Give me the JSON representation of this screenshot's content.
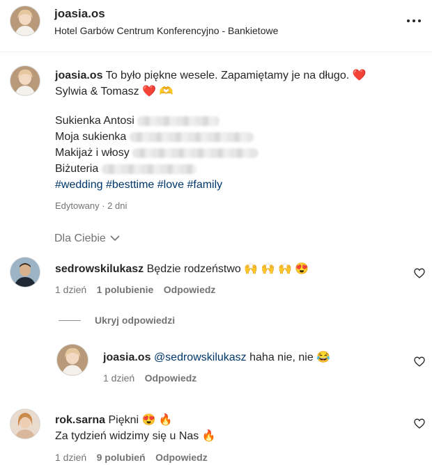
{
  "header": {
    "username": "joasia.os",
    "location": "Hotel Garbów Centrum Konferencyjno - Bankietowe"
  },
  "caption": {
    "username": "joasia.os",
    "line1": "To było piękne wesele. Zapamiętamy je na długo. ❤️",
    "line2": "Sylwia & Tomasz ❤️ 🫶",
    "credit1": "Sukienka Antosi",
    "credit2": "Moja sukienka",
    "credit3": "Makijaż i włosy",
    "credit4": "Biżuteria",
    "hashtags": [
      "#wedding",
      "#besttime",
      "#love",
      "#family"
    ],
    "edited": "Edytowany · 2 dni"
  },
  "sort": {
    "label": "Dla Ciebie"
  },
  "comments": [
    {
      "username": "sedrowskilukasz",
      "text": "Będzie rodzeństwo 🙌 🙌 🙌 😍",
      "time": "1 dzień",
      "likes": "1 polubienie",
      "reply": "Odpowiedz",
      "hide_replies": "Ukryj odpowiedzi",
      "replies": [
        {
          "username": "joasia.os",
          "mention": "@sedrowskilukasz",
          "text": "haha nie, nie 😂",
          "time": "1 dzień",
          "reply": "Odpowiedz"
        }
      ]
    },
    {
      "username": "rok.sarna",
      "text": "Piękni 😍 🔥",
      "text2": "Za tydzień widzimy się u Nas 🔥",
      "time": "1 dzień",
      "likes": "9 polubień",
      "reply": "Odpowiedz"
    }
  ],
  "icons": {
    "more": "more-options-icon",
    "like": "heart-outline-icon",
    "sort": "chevron-down-icon"
  }
}
